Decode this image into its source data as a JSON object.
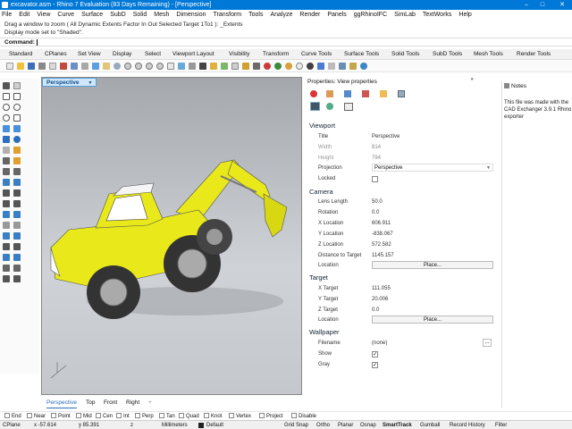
{
  "window": {
    "title": "excavator.asm - Rhino 7 Evaluation (83 Days Remaining) - [Perspective]"
  },
  "menu": [
    "File",
    "Edit",
    "View",
    "Curve",
    "Surface",
    "SubD",
    "Solid",
    "Mesh",
    "Dimension",
    "Transform",
    "Tools",
    "Analyze",
    "Render",
    "Panels",
    "ggRhinoIFC",
    "SimLab",
    "TextWorks",
    "Help"
  ],
  "command_history": [
    "Drag a window to zoom ( All  Dynamic  Extents  Factor  In  Out  Selected  Target  1To1 ): _Extents",
    "Display mode set to \"Shaded\"."
  ],
  "command": {
    "label": "Command:"
  },
  "toolbar_tabs": [
    "Standard",
    "CPlanes",
    "Set View",
    "Display",
    "Select",
    "Viewport Layout",
    "Visibility",
    "Transform",
    "Curve Tools",
    "Surface Tools",
    "Solid Tools",
    "SubD Tools",
    "Mesh Tools",
    "Render Tools"
  ],
  "viewport": {
    "label": "Perspective",
    "tabs": [
      "Perspective",
      "Top",
      "Front",
      "Right"
    ],
    "add": "+"
  },
  "properties": {
    "header": "Properties: View properties",
    "viewport": {
      "section": "Viewport",
      "title_label": "Title",
      "title": "Perspective",
      "width_label": "Width",
      "width": "814",
      "height_label": "Height",
      "height": "794",
      "projection_label": "Projection",
      "projection": "Perspective",
      "locked_label": "Locked"
    },
    "camera": {
      "section": "Camera",
      "lens_label": "Lens Length",
      "lens": "50.0",
      "rotation_label": "Rotation",
      "rotation": "0.0",
      "xloc_label": "X Location",
      "xloc": "606.911",
      "yloc_label": "Y Location",
      "yloc": "-838.067",
      "zloc_label": "Z Location",
      "zloc": "572.582",
      "dist_label": "Distance to Target",
      "dist": "1145.157",
      "location_label": "Location",
      "place_btn": "Place..."
    },
    "target": {
      "section": "Target",
      "xt_label": "X Target",
      "xt": "111.055",
      "yt_label": "Y Target",
      "yt": "20.006",
      "zt_label": "Z Target",
      "zt": "0.0",
      "location_label": "Location",
      "place_btn": "Place..."
    },
    "wallpaper": {
      "section": "Wallpaper",
      "filename_label": "Filename",
      "filename": "(none)",
      "browse": "...",
      "show_label": "Show",
      "gray_label": "Gray"
    }
  },
  "notes": {
    "header": "Notes",
    "text": "This file was made with the CAD Exchanger 3.9.1 Rhino exporter"
  },
  "osnaps": [
    "End",
    "Near",
    "Point",
    "Mid",
    "Cen",
    "Int",
    "Perp",
    "Tan",
    "Quad",
    "Knot",
    "Vertex",
    "Project",
    "Disable"
  ],
  "status": {
    "cplane": "CPlane",
    "x": "x -57.614",
    "y": "y 85.391",
    "z": "z",
    "units": "Millimeters",
    "layer": "Default",
    "toggles": [
      "Grid Snap",
      "Ortho",
      "Planar",
      "Osnap",
      "SmartTrack",
      "Gumball",
      "Record History",
      "Filter"
    ]
  },
  "colors": {
    "titlebar": "#0078d7",
    "excavator_yellow": "#e8e81a",
    "viewport_bg": "#b8bcc0"
  }
}
